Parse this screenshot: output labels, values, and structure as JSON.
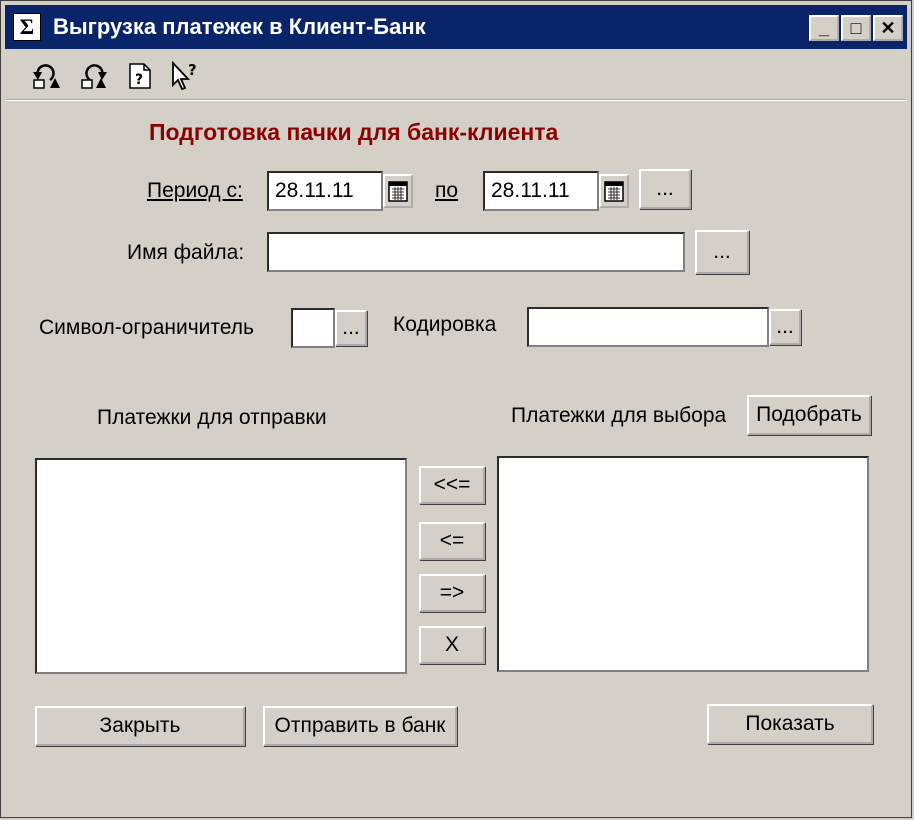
{
  "window": {
    "title": "Выгрузка платежек в Клиент-Банк",
    "minimize": "_",
    "maximize": "□",
    "close": "✕"
  },
  "toolbar": {
    "icons": [
      "undo-icon",
      "redo-icon",
      "help-document-icon",
      "context-help-icon"
    ]
  },
  "form": {
    "heading": "Подготовка пачки для банк-клиента",
    "period_from_label": "Период с:",
    "period_from_value": "28.11.11",
    "period_to_label": "по",
    "period_to_value": "28.11.11",
    "period_button": "...",
    "filename_label": "Имя файла:",
    "filename_value": "",
    "filename_button": "...",
    "delimiter_label": "Символ-ограничитель",
    "delimiter_value": "",
    "delimiter_button": "...",
    "encoding_label": "Кодировка",
    "encoding_value": "",
    "encoding_button": "..."
  },
  "lists": {
    "to_send_label": "Платежки для отправки",
    "to_select_label": "Платежки для выбора",
    "select_button": "Подобрать",
    "move_all_left": "<<=",
    "move_left": "<=",
    "move_right": "=>",
    "remove": "X"
  },
  "footer": {
    "close_button": "Закрыть",
    "send_button": "Отправить в банк",
    "show_button": "Показать"
  }
}
